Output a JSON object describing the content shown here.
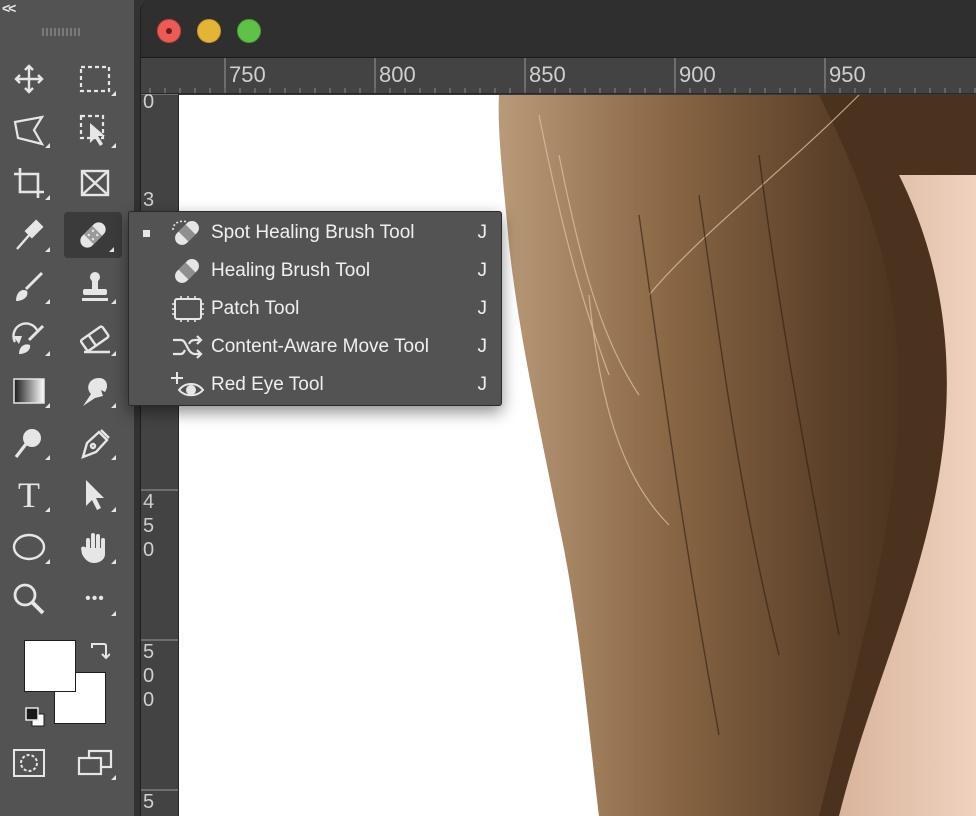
{
  "toolbar": {
    "collapse_glyph": "<<",
    "tools": [
      {
        "name": "move-tool",
        "icon": "move-icon"
      },
      {
        "name": "rectangular-marquee-tool",
        "icon": "marquee-icon"
      },
      {
        "name": "lasso-tool",
        "icon": "lasso-icon"
      },
      {
        "name": "object-selection-tool",
        "icon": "object-selection-icon"
      },
      {
        "name": "crop-tool",
        "icon": "crop-icon"
      },
      {
        "name": "frame-tool",
        "icon": "frame-icon"
      },
      {
        "name": "eyedropper-tool",
        "icon": "eyedropper-icon"
      },
      {
        "name": "spot-healing-brush-tool",
        "icon": "bandage-icon",
        "active": true
      },
      {
        "name": "brush-tool",
        "icon": "brush-icon"
      },
      {
        "name": "clone-stamp-tool",
        "icon": "stamp-icon"
      },
      {
        "name": "history-brush-tool",
        "icon": "history-brush-icon"
      },
      {
        "name": "eraser-tool",
        "icon": "eraser-icon"
      },
      {
        "name": "gradient-tool",
        "icon": "gradient-icon"
      },
      {
        "name": "smudge-tool",
        "icon": "smudge-icon"
      },
      {
        "name": "dodge-tool",
        "icon": "dodge-icon"
      },
      {
        "name": "pen-tool",
        "icon": "pen-icon"
      },
      {
        "name": "type-tool",
        "icon": "type-icon"
      },
      {
        "name": "path-selection-tool",
        "icon": "arrow-icon"
      },
      {
        "name": "ellipse-tool",
        "icon": "ellipse-icon"
      },
      {
        "name": "hand-tool",
        "icon": "hand-icon"
      },
      {
        "name": "zoom-tool",
        "icon": "zoom-icon"
      },
      {
        "name": "edit-toolbar",
        "icon": "more-icon"
      },
      {
        "name": "quick-mask-mode",
        "icon": "quick-mask-icon"
      },
      {
        "name": "screen-mode",
        "icon": "screen-mode-icon"
      }
    ],
    "type_glyph": "T",
    "more_glyph": "•••",
    "foreground_color": "#ffffff",
    "background_color": "#ffffff"
  },
  "ruler": {
    "horizontal": [
      "750",
      "800",
      "850",
      "900",
      "950"
    ],
    "vertical": [
      "0",
      "3",
      "4",
      "5",
      "0",
      "5",
      "0",
      "0",
      "5"
    ]
  },
  "flyout": {
    "items": [
      {
        "label": "Spot Healing Brush Tool",
        "shortcut": "J",
        "icon": "spot-healing-icon",
        "selected": true
      },
      {
        "label": "Healing Brush Tool",
        "shortcut": "J",
        "icon": "healing-brush-icon"
      },
      {
        "label": "Patch Tool",
        "shortcut": "J",
        "icon": "patch-icon"
      },
      {
        "label": "Content-Aware Move Tool",
        "shortcut": "J",
        "icon": "content-aware-move-icon"
      },
      {
        "label": "Red Eye Tool",
        "shortcut": "J",
        "icon": "red-eye-icon"
      }
    ]
  },
  "colors": {
    "toolbar_bg": "#535353",
    "titlebar_bg": "#2f2f2f",
    "ruler_bg": "#434343",
    "close": "#ec5b55",
    "minimize": "#e4b434",
    "zoom": "#5fc148"
  }
}
